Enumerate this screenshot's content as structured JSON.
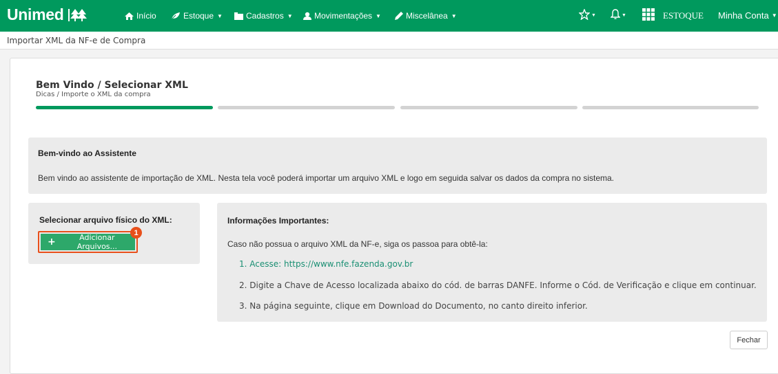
{
  "brand": {
    "name": "Unimed",
    "color": "#00995d"
  },
  "nav": {
    "items": [
      {
        "label": "Início",
        "icon": "home-icon",
        "has_caret": false
      },
      {
        "label": "Estoque",
        "icon": "leaf-icon",
        "has_caret": true
      },
      {
        "label": "Cadastros",
        "icon": "folder-icon",
        "has_caret": true
      },
      {
        "label": "Movimentações",
        "icon": "users-icon",
        "has_caret": true
      },
      {
        "label": "Miscelânea",
        "icon": "pencil-icon",
        "has_caret": true
      }
    ],
    "module_label": "ESTOQUE",
    "account_label": "Minha Conta"
  },
  "breadcrumb": "Importar XML da NF-e de Compra",
  "wizard": {
    "title": "Bem Vindo / Selecionar XML",
    "subtitle": "Dicas / Importe o XML da compra",
    "steps_total": 4,
    "current_step": 1
  },
  "welcome": {
    "title": "Bem-vindo ao Assistente",
    "text": "Bem vindo ao assistente de importação de XML. Nesta tela você poderá importar um arquivo XML e logo em seguida salvar os dados da compra no sistema."
  },
  "select_file": {
    "title": "Selecionar arquivo físico do XML:",
    "button_label": "Adicionar Arquivos...",
    "badge": "1"
  },
  "info": {
    "title": "Informações Importantes:",
    "lead": "Caso não possua o arquivo XML da NF-e, siga os passoa para obtê-la:",
    "steps": [
      "1. Acesse: https://www.nfe.fazenda.gov.br",
      "2. Digite a Chave de Acesso localizada abaixo do cód. de barras DANFE. Informe o Cód. de Verificação e clique em continuar.",
      "3. Na página seguinte, clique em Download do Documento, no canto direito inferior."
    ]
  },
  "footer": {
    "close_label": "Fechar"
  }
}
